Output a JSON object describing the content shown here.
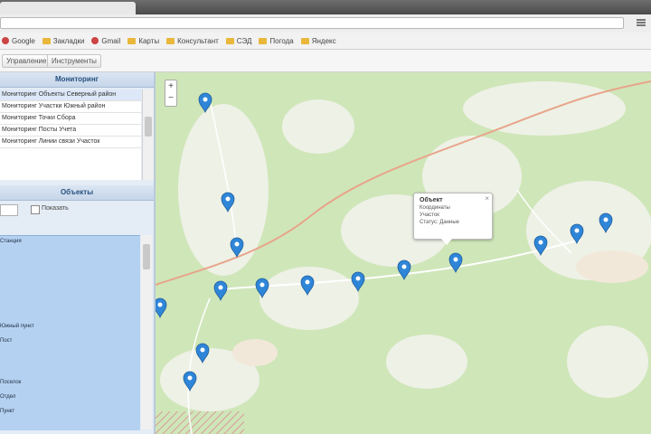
{
  "browser": {
    "url": "",
    "bookmarks": [
      "Google",
      "Закладки",
      "Gmail",
      "Карты",
      "Консультант",
      "СЭД",
      "Погода",
      "Яндекс"
    ]
  },
  "toolbar": {
    "button1": "Управление",
    "button2": "Инструменты",
    "right_text": ""
  },
  "left_panel": {
    "layers_title": "Мониторинг",
    "layers": [
      "Мониторинг Объекты Северный район",
      "Мониторинг Участки Южный район",
      "Мониторинг Точки Сбора",
      "Мониторинг Посты Учета",
      "Мониторинг Линии связи Участок"
    ],
    "objects_title": "Объекты",
    "filter_label": "Показать",
    "objects": [
      "Станция",
      "",
      "",
      "",
      "",
      "",
      "Южный пункт",
      "Пост",
      "",
      "",
      "",
      "Поселок",
      "Отдел",
      "",
      "Пункт"
    ]
  },
  "map": {
    "popup": {
      "title": "Объект",
      "lines": [
        "Координаты",
        "Участок",
        "Статус: Данные"
      ]
    }
  },
  "colors": {
    "marker": "#2f86d8",
    "panel_header": "#c6d6e9",
    "objects_bg": "#b5d1f2",
    "map_bg": "#cfe6b9"
  },
  "icons": {
    "marker": "map-marker-icon",
    "zoom_in": "zoom-in-icon",
    "zoom_out": "zoom-out-icon",
    "close": "close-icon"
  }
}
